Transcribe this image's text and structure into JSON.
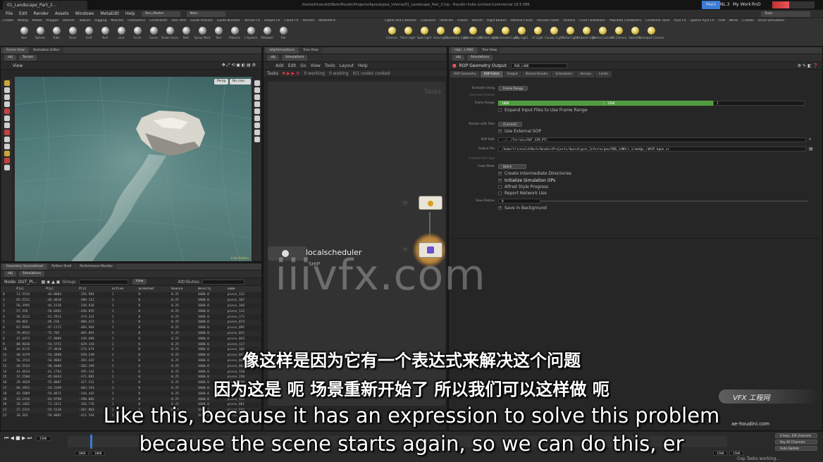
{
  "os": {
    "tab_title": "01_Landscape_Part_2...",
    "window_title": "/home/tricecold/Work/HoudiniProjects/Apocalypse_Inferno/01_Landscape_Part_2.hip - Houdini Indie Limited-Commercial 18.5.586",
    "desktops": [
      "Main",
      "NL.3",
      "My Work",
      "RnD"
    ]
  },
  "menubar": {
    "items": [
      "File",
      "Edit",
      "Render",
      "Assets",
      "Windows",
      "MetaEdit",
      "Help"
    ],
    "dropdown_a": "Tom_Master",
    "dropdown_b": "Main"
  },
  "shelf": {
    "tabs_left": [
      "Create",
      "Modify",
      "Model",
      "Polygon",
      "Deform",
      "Texture",
      "Rigging",
      "Muscles",
      "Characters",
      "Constraints",
      "Hair Utils",
      "Guide Process",
      "Guide Brushes",
      "Terrain FX",
      "Simple FX",
      "Cloud FX",
      "Volume",
      "RedshiftFX"
    ],
    "tools_left": [
      "Box",
      "Sphere",
      "Tube",
      "Torus",
      "Grid",
      "Null",
      "Line",
      "Circle",
      "Curve",
      "Draw Curve",
      "Path",
      "Spray Paint",
      "Text",
      "Platonic",
      "L-System",
      "Metaball",
      "File"
    ],
    "tabs_right": [
      "Lights and Cameras",
      "Collisions",
      "Particles",
      "Grains",
      "Vellum",
      "Rigid Bodies",
      "Particle Fluids",
      "Viscous Fluids",
      "Oceans",
      "Fluid Containers",
      "Populate Containers",
      "Container Tools",
      "Pyro FX",
      "Sparse Pyro FX",
      "FEM",
      "Wires",
      "Crowds",
      "Drive Simulation"
    ],
    "tools_right": [
      "Camera",
      "Point Light",
      "Spot Light",
      "Area Light",
      "Geometry Light",
      "Volume Light",
      "Distant Light",
      "Environment Light",
      "Sky Light",
      "GI Light",
      "Caustic Light",
      "Portal Light",
      "Ambient Light",
      "Stereo Camera",
      "VR Camera",
      "Switcher",
      "Gamepad Camera"
    ],
    "right_dropdown": "Tools"
  },
  "left_pane": {
    "tabs": [
      "Scene View",
      "Animation Editor"
    ],
    "path": "obj",
    "object": "Terrain",
    "view_label": "View",
    "persp_label": "Persp",
    "cam_label": "No cam",
    "viewport_corner": "Indie Edition"
  },
  "spreadsheet": {
    "tabs": [
      "Geometry Spreadsheet",
      "Python Shell",
      "Performance Monitor"
    ],
    "path_obj": "obj",
    "path_node": "Simulations",
    "node_label": "Node: OUT_PI...",
    "group_label": "Group:",
    "view_label": "View",
    "attributes_label": "Attributes:",
    "columns": [
      "",
      "P[x]",
      "P[y]",
      "P[z]",
      "active",
      "animated",
      "bounce",
      "density",
      "name"
    ],
    "rows": [
      [
        "0",
        "11.5534",
        "-44.0004",
        "-356.983",
        "1",
        "0",
        "0.25",
        "1000.0",
        "piece_122"
      ],
      [
        "1",
        "65.5511",
        "-46.4810",
        "-389.112",
        "1",
        "0",
        "0.25",
        "1000.0",
        "piece_107"
      ],
      [
        "2",
        "56.3995",
        "-44.1536",
        "-350.936",
        "1",
        "0",
        "0.25",
        "1000.0",
        "piece_166"
      ],
      [
        "3",
        "57.256",
        "-56.0481",
        "-436.925",
        "1",
        "0",
        "0.25",
        "1000.0",
        "piece_112"
      ],
      [
        "4",
        "56.3211",
        "-61.5912",
        "-374.332",
        "1",
        "0",
        "0.25",
        "1000.0",
        "piece_171"
      ],
      [
        "5",
        "68.064",
        "-46.226",
        "-406.472",
        "1",
        "0",
        "0.25",
        "1000.0",
        "piece_074"
      ],
      [
        "6",
        "62.9494",
        "-67.1172",
        "-404.964",
        "1",
        "0",
        "0.25",
        "1000.0",
        "piece_095"
      ],
      [
        "7",
        "79.0913",
        "-75.765",
        "-405.892",
        "1",
        "0",
        "0.25",
        "1000.0",
        "piece_031"
      ],
      [
        "8",
        "47.4473",
        "-77.9099",
        "-338.689",
        "1",
        "0",
        "0.25",
        "1000.0",
        "piece_043"
      ],
      [
        "9",
        "88.9016",
        "-54.5751",
        "-429.154",
        "1",
        "0",
        "0.25",
        "1000.0",
        "piece_117"
      ],
      [
        "10",
        "44.8115",
        "-77.4010",
        "-374.674",
        "1",
        "0",
        "0.25",
        "1000.0",
        "piece_102"
      ],
      [
        "11",
        "48.3379",
        "-54.2890",
        "-350.249",
        "1",
        "0",
        "0.25",
        "1000.0",
        "piece_042"
      ],
      [
        "12",
        "56.1554",
        "-56.9883",
        "-393.432",
        "1",
        "0",
        "0.25",
        "1000.0",
        "piece_081"
      ],
      [
        "13",
        "46.5533",
        "-58.4406",
        "-382.199",
        "1",
        "0",
        "0.25",
        "1000.0",
        "piece_065"
      ],
      [
        "14",
        "41.6614",
        "-61.1763",
        "-395.142",
        "1",
        "0",
        "0.25",
        "1000.0",
        "piece_128"
      ],
      [
        "15",
        "37.5504",
        "-45.6643",
        "-371.881",
        "1",
        "0",
        "0.25",
        "1000.0",
        "piece_150"
      ],
      [
        "16",
        "29.4029",
        "-55.8087",
        "-327.531",
        "1",
        "0",
        "0.25",
        "1000.0",
        "piece_099"
      ],
      [
        "17",
        "84.3953",
        "-54.2349",
        "-403.193",
        "1",
        "0",
        "0.25",
        "1000.0",
        "piece_077"
      ],
      [
        "18",
        "42.5889",
        "-54.0671",
        "-344.442",
        "1",
        "0",
        "0.25",
        "1000.0",
        "piece_007"
      ],
      [
        "19",
        "32.1916",
        "-63.9790",
        "-390.002",
        "1",
        "0",
        "0.25",
        "1000.0",
        "piece_139"
      ],
      [
        "20",
        "28.1462",
        "-71.2411",
        "-356.776",
        "1",
        "0",
        "0.25",
        "1000.0",
        "piece_061"
      ],
      [
        "21",
        "27.2311",
        "-55.5116",
        "-367.003",
        "1",
        "0",
        "0.25",
        "1000.0",
        "piece_048"
      ],
      [
        "22",
        "36.363",
        "-59.0881",
        "-411.544",
        "1",
        "0",
        "0.25",
        "1000.0",
        "piece_154"
      ]
    ]
  },
  "network": {
    "tabs": [
      "/obj/Simulations",
      "Tree View"
    ],
    "path_obj": "obj",
    "path_node": "Simulations",
    "menu": [
      "Add",
      "Edit",
      "Go",
      "View",
      "Tools",
      "Layout",
      "Help"
    ],
    "tasks_label": "Tasks",
    "working": "0 working",
    "waiting": "0 waiting",
    "nodes_cooked": "0/1 nodes cooked",
    "corner_label": "Tasks",
    "scheduler_label": "localscheduler",
    "scheduler_sub": "SHIP"
  },
  "params": {
    "tabs_header": [
      "/obj/...LAND",
      "Tree View"
    ],
    "path_obj": "obj",
    "path_node": "Simulations",
    "node_type": "ROP Geometry Output",
    "node_name": "ROB_LAND",
    "tabs": [
      "ROP Geometry",
      "ROP Fetch",
      "Output",
      "Shared Render",
      "Schedulers",
      "Version",
      "Limits"
    ],
    "active_tab": "ROP Fetch",
    "evaluate_label": "Evaluate Using",
    "evaluate_value": "Frame Range",
    "override_label": "Override Frames",
    "frame_range_label": "Frame Range",
    "frame_start": "1000",
    "frame_end": "1500",
    "frame_inc": "1",
    "expand_label": "Expand Input Files to Use Frame Range",
    "render_label": "Render with Take",
    "render_value": "(Current)",
    "use_sop_label": "Use External SOP",
    "sop_path_label": "SOP Path",
    "sop_path": "../../Terrain/OUT_SIM_PTC",
    "output_label": "Output File",
    "output_file": "/home/tricecold/Work/HoudiniProjects/Apocalypse_Inferno/geo/ROB_LAND/v_1/amdgo_/$HIP.bgeo.sc",
    "initialize_label": "Initialize Sim Ops",
    "cook_mode_label": "Cook Mode",
    "cook_mode_value": "Batch",
    "create_dirs": "Create Intermediate Directories",
    "initialize_sim": "Initialize Simulation OPs",
    "alfred": "Alfred Style Progress",
    "report": "Report Network Use",
    "save_label": "Save Retries",
    "save_value": "0",
    "background_label": "Save in Background"
  },
  "timeline": {
    "frame_current": "1500",
    "frame_start": "1000",
    "frame_end": "1000",
    "range_end_a": "1500",
    "range_end_b": "1500",
    "status": "Cop Tasks working...",
    "keys_label": "0 keys, 0/0 channels",
    "key_all": "Key All Channels",
    "auto_update": "Auto Update"
  },
  "subtitles": {
    "zh_line1": "像这样是因为它有一个表达式来解决这个问题",
    "zh_line2": "因为这是 呃 场景重新开始了 所以我们可以这样做 呃",
    "en_line1": "Like this, because it has an expression to solve this problem",
    "en_line2": "because the scene starts again, so we can do this, er"
  },
  "overlays": {
    "watermark": "iiivfx.com",
    "vfx_badge": "VFX 工程网",
    "site": "ae-houdini.com"
  },
  "colors": {
    "frame_bar": "#4e9a3e",
    "accent_blue": "#3a7bd5"
  }
}
